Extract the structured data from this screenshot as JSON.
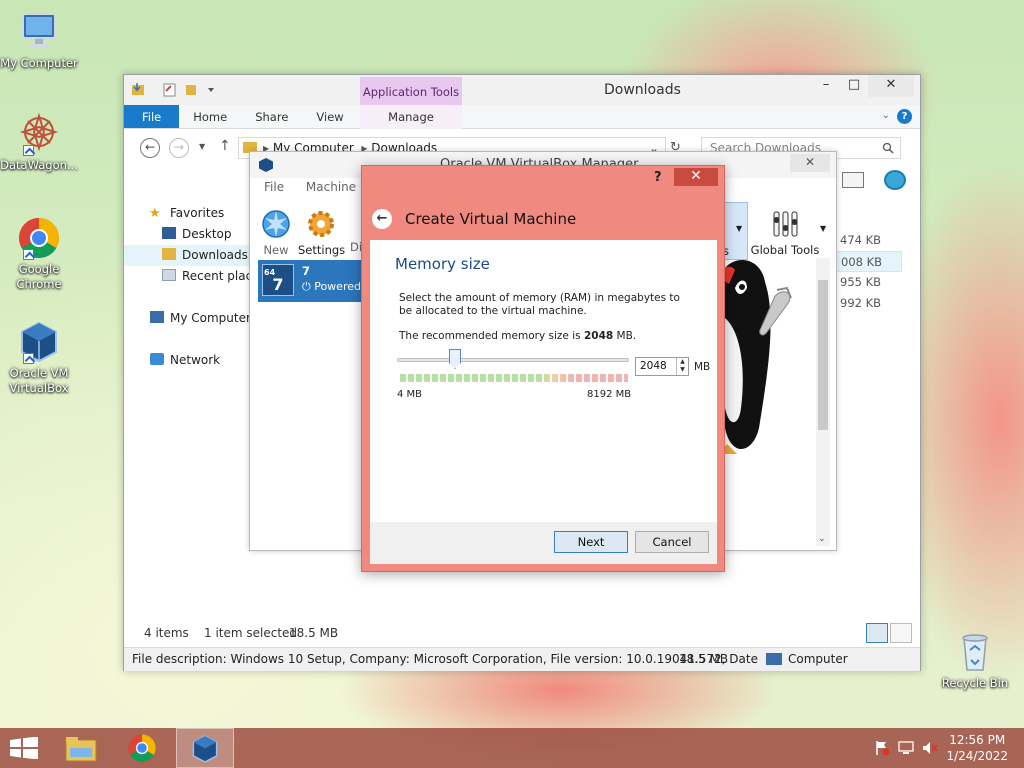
{
  "desktop": {
    "icons": [
      {
        "label": "My Computer"
      },
      {
        "label": "DataWagon..."
      },
      {
        "label": "Google Chrome"
      },
      {
        "label": "Oracle VM VirtualBox"
      },
      {
        "label": "Recycle Bin"
      }
    ]
  },
  "explorer": {
    "title": "Downloads",
    "context_tab": "Application Tools",
    "tabs": [
      "File",
      "Home",
      "Share",
      "View",
      "Manage"
    ],
    "address": [
      "My Computer",
      "Downloads"
    ],
    "search_placeholder": "Search Downloads",
    "nav": {
      "favorites": "Favorites",
      "desktop": "Desktop",
      "downloads": "Downloads",
      "recent": "Recent place",
      "computer": "My Computer",
      "network": "Network"
    },
    "file_sizes": [
      "474 KB",
      "008 KB",
      "955 KB",
      "992 KB"
    ],
    "status": {
      "items": "4 items",
      "selected": "1 item selected",
      "size": "18.5 MB"
    },
    "details_bar": {
      "description": "File description: Windows 10 Setup, Company: Microsoft Corporation, File version: 10.0.19041.572, Date",
      "size": "18.5 MB",
      "location": "Computer"
    }
  },
  "virtualbox": {
    "title": "Oracle VM VirtualBox Manager",
    "menu": [
      "File",
      "Machine"
    ],
    "tools": {
      "new": "New",
      "settings": "Settings",
      "discard": "Di",
      "global": "Global Tools",
      "machine_tail": "s"
    },
    "vm": {
      "name": "7",
      "state": "Powered",
      "badge": "64",
      "os_short": "7"
    }
  },
  "dialog": {
    "help": "?",
    "close": "✕",
    "title": "Create Virtual Machine",
    "section": "Memory size",
    "description": "Select the amount of memory (RAM) in megabytes to be allocated to the virtual machine.",
    "recommended_prefix": "The recommended memory size is",
    "recommended_value": "2048",
    "recommended_suffix": "MB.",
    "memory_value": "2048",
    "unit": "MB",
    "slider_min": "4 MB",
    "slider_max": "8192 MB",
    "slider_fraction": 0.25,
    "next": "Next",
    "cancel": "Cancel"
  },
  "taskbar": {
    "time": "12:56 PM",
    "date": "1/24/2022"
  },
  "colors": {
    "accent": "#1979ca",
    "dialog_frame": "#f08a80",
    "taskbar": "#9c4c40",
    "vm_selected": "#2c76bd"
  },
  "icon_names": [
    "computer-icon",
    "datawagon-icon",
    "chrome-icon",
    "virtualbox-icon",
    "recycle-bin-icon",
    "start-icon",
    "file-explorer-icon"
  ]
}
